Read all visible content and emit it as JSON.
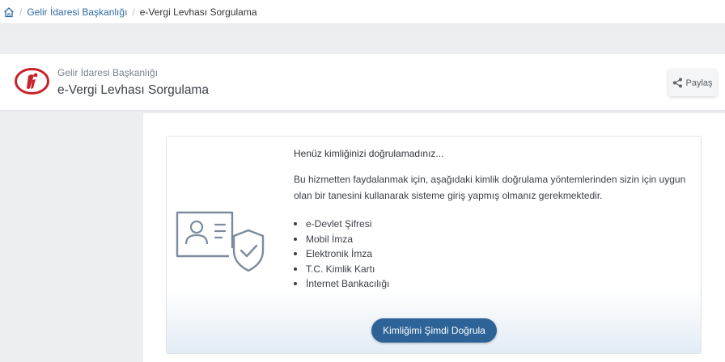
{
  "breadcrumb": {
    "home_icon": "home-icon",
    "separator": "/",
    "items": [
      "Gelir İdaresi Başkanlığı",
      "e-Vergi Levhası Sorgulama"
    ]
  },
  "header": {
    "logo_icon": "gib-logo",
    "subtitle": "Gelir İdaresi Başkanlığı",
    "title": "e-Vergi Levhası Sorgulama",
    "share_label": "Paylaş",
    "share_icon": "share-icon"
  },
  "auth_notice": {
    "illustration": "id-card-shield-icon",
    "heading": "Henüz kimliğinizi doğrulamadınız...",
    "description": "Bu hizmetten faydalanmak için, aşağıdaki kimlik doğrulama yöntemlerinden sizin için uygun olan bir tanesini kullanarak sisteme giriş yapmış olmanız gerekmektedir.",
    "methods": [
      "e-Devlet Şifresi",
      "Mobil İmza",
      "Elektronik İmza",
      "T.C. Kimlik Kartı",
      "İnternet Bankacılığı"
    ],
    "verify_button": "Kimliğimi Şimdi Doğrula"
  },
  "colors": {
    "primary_button": "#2e6398",
    "link": "#2d6aa3",
    "logo_red": "#c8232b",
    "page_background": "#eceef1"
  }
}
